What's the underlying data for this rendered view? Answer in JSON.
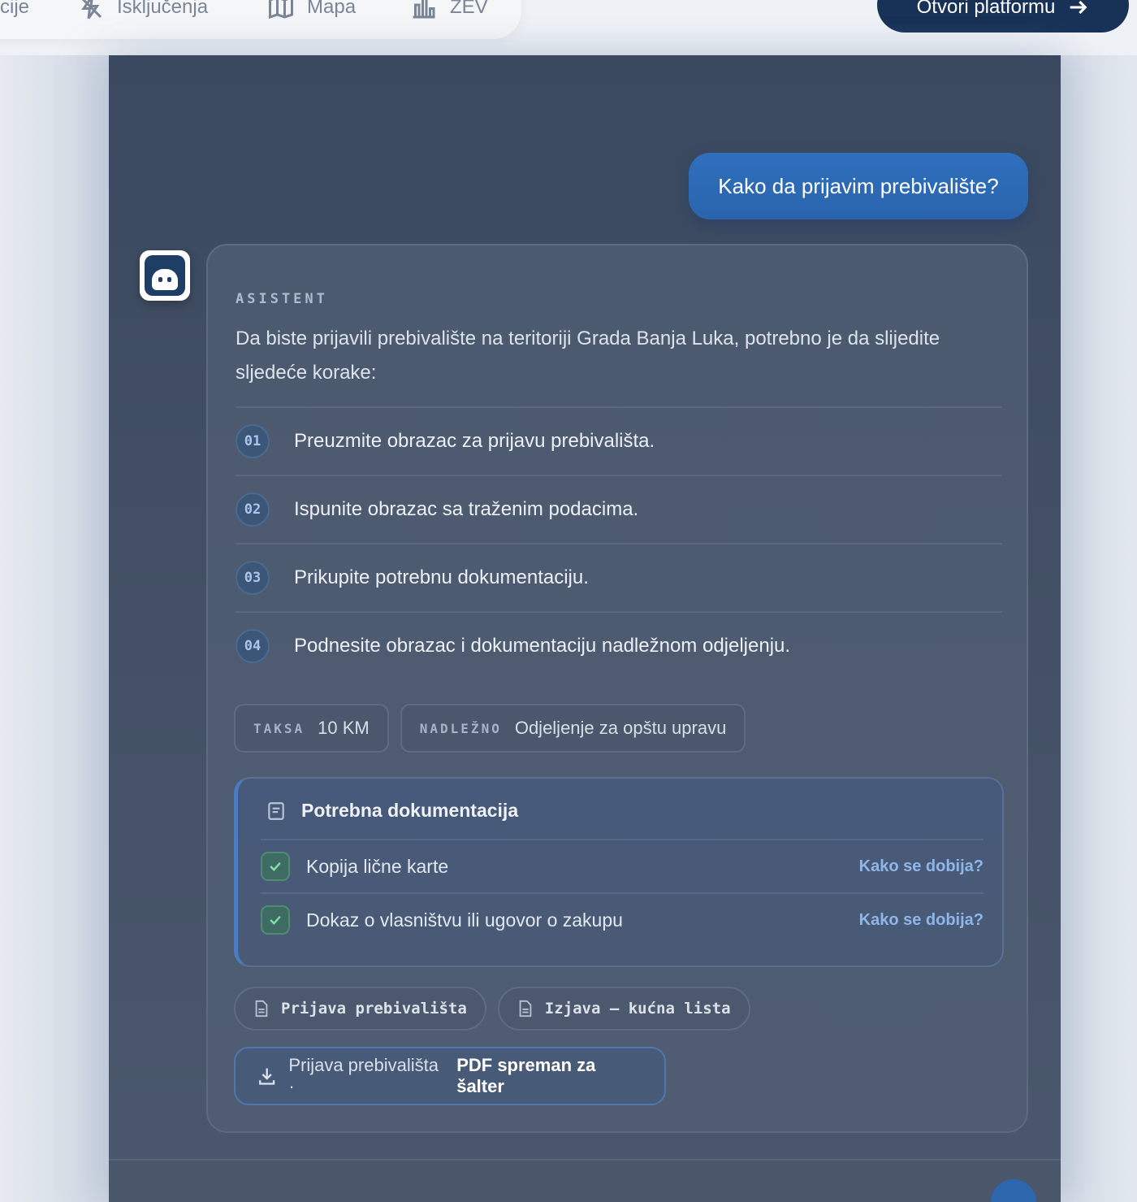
{
  "nav": {
    "items": [
      {
        "label": "cije",
        "icon": "none"
      },
      {
        "label": "Isključenja",
        "icon": "lightning-off-icon"
      },
      {
        "label": "Mapa",
        "icon": "map-icon"
      },
      {
        "label": "ZEV",
        "icon": "chart-icon"
      }
    ],
    "open_platform": "Otvori platformu"
  },
  "chat": {
    "user_message": "Kako da prijavim prebivalište?",
    "assistant_label": "ASISTENT",
    "intro": "Da biste prijavili prebivalište na teritoriji Grada Banja Luka, potrebno je da slijedite sljedeće korake:",
    "steps": [
      {
        "num": "01",
        "text": "Preuzmite obrazac za prijavu prebivališta."
      },
      {
        "num": "02",
        "text": "Ispunite obrazac sa traženim podacima."
      },
      {
        "num": "03",
        "text": "Prikupite potrebnu dokumentaciju."
      },
      {
        "num": "04",
        "text": "Podnesite obrazac i dokumentaciju nadležnom odjeljenju."
      }
    ],
    "chips": [
      {
        "label": "TAKSA",
        "value": "10 KM"
      },
      {
        "label": "NADLEŽNO",
        "value": "Odjeljenje za opštu upravu"
      }
    ],
    "docs": {
      "title": "Potrebna dokumentacija",
      "items": [
        {
          "text": "Kopija lične karte",
          "link": "Kako se dobija?"
        },
        {
          "text": "Dokaz o vlasništvu ili ugovor o zakupu",
          "link": "Kako se dobija?"
        }
      ]
    },
    "forms": [
      "Prijava prebivališta",
      "Izjava – kućna lista"
    ],
    "pdf": {
      "prefix": "Prijava prebivališta ·",
      "strong": "PDF spreman za šalter"
    }
  },
  "colors": {
    "accent": "#2f6fbd",
    "nav_button": "#183257",
    "panel": "#414e63"
  }
}
